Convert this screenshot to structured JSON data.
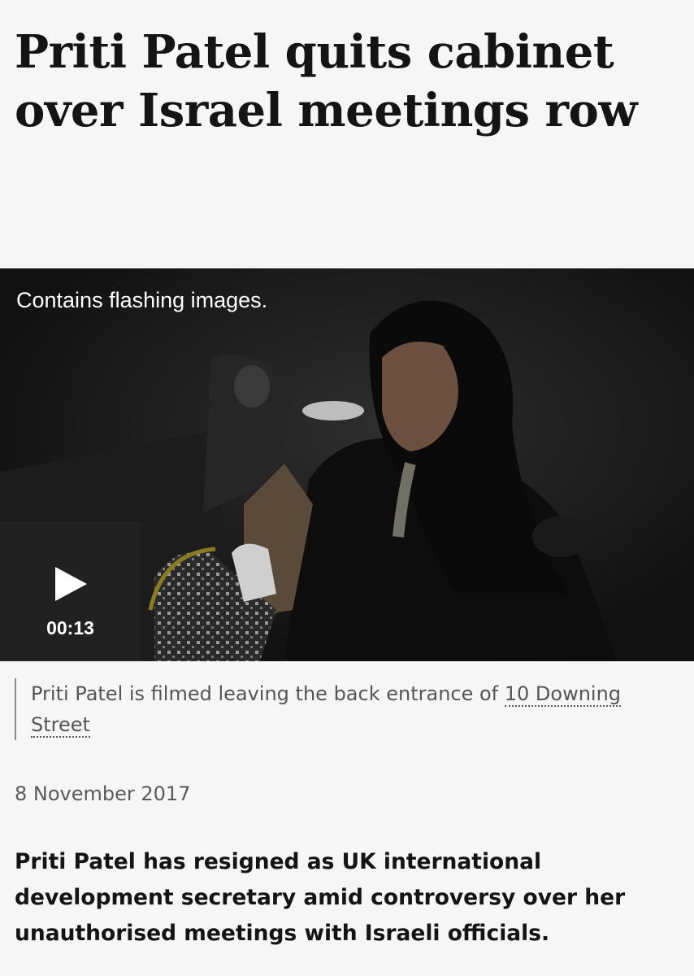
{
  "headline": "Priti Patel quits cabinet over Israel meetings row",
  "video": {
    "warning": "Contains flashing images.",
    "duration": "00:13",
    "play_icon": "play-icon"
  },
  "caption": {
    "text": "Priti Patel is filmed leaving the back entrance of ",
    "link_text": "10 Downing Street"
  },
  "date": "8 November 2017",
  "intro": "Priti Patel has resigned as UK international development secretary amid controversy over her unauthorised meetings with Israeli officials.",
  "colors": {
    "background": "#f6f6f6",
    "text": "#141414",
    "muted": "#555555",
    "video_bg": "#151515"
  }
}
